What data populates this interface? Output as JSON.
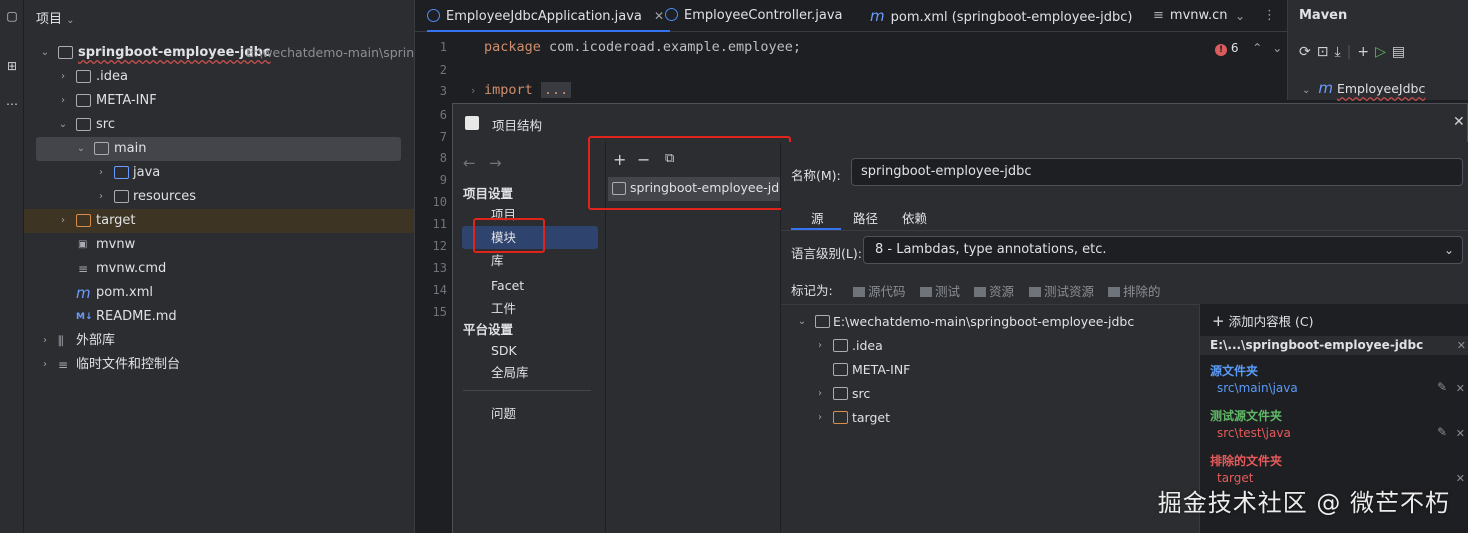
{
  "project": {
    "header": "项目",
    "tree": [
      {
        "label": "springboot-employee-jdbc",
        "path": "E:\\wechatdemo-main\\springb"
      },
      {
        "label": ".idea"
      },
      {
        "label": "META-INF"
      },
      {
        "label": "src"
      },
      {
        "label": "main"
      },
      {
        "label": "java"
      },
      {
        "label": "resources"
      },
      {
        "label": "target"
      },
      {
        "label": "mvnw"
      },
      {
        "label": "mvnw.cmd"
      },
      {
        "label": "pom.xml"
      },
      {
        "label": "README.md"
      },
      {
        "label": "外部库"
      },
      {
        "label": "临时文件和控制台"
      }
    ]
  },
  "editor": {
    "tabs": [
      {
        "label": "EmployeeJdbcApplication.java"
      },
      {
        "label": "EmployeeController.java"
      },
      {
        "label": "pom.xml (springboot-employee-jdbc)"
      },
      {
        "label": "mvnw.cn"
      }
    ],
    "line_numbers": [
      "1",
      "2",
      "3",
      "6",
      "7",
      "8",
      "9",
      "10",
      "11",
      "12",
      "13",
      "14",
      "15"
    ],
    "code": {
      "line1_kw": "package",
      "line1_rest": "com.icoderoad.example.employee;",
      "line3_kw": "import",
      "line3_rest": "..."
    },
    "problems_count": "6"
  },
  "maven": {
    "title": "Maven",
    "project_item": "EmployeeJdbc"
  },
  "dialog": {
    "title": "项目结构",
    "nav": {
      "project_settings_header": "项目设置",
      "items": [
        "项目",
        "模块",
        "库",
        "Facet",
        "工件"
      ],
      "platform_settings_header": "平台设置",
      "platform_items": [
        "SDK",
        "全局库"
      ],
      "problems": "问题"
    },
    "modules": {
      "module_name": "springboot-employee-jdbc"
    },
    "detail": {
      "name_label": "名称(M):",
      "name_value": "springboot-employee-jdbc",
      "tabs": [
        "源",
        "路径",
        "依赖"
      ],
      "language_level_label": "语言级别(L):",
      "language_level_value": "8 - Lambdas, type annotations, etc.",
      "mark_as_label": "标记为:",
      "mark_items": [
        "源代码",
        "测试",
        "资源",
        "测试资源",
        "排除的"
      ],
      "root_tree": [
        "E:\\wechatdemo-main\\springboot-employee-jdbc",
        ".idea",
        "META-INF",
        "src",
        "target"
      ],
      "add_content_root": "添加内容根 (C)",
      "content_root_title": "E:\\...\\springboot-employee-jdbc",
      "source_folders_label": "源文件夹",
      "source_folder_path": "src\\main\\java",
      "test_source_label": "测试源文件夹",
      "test_source_path": "src\\test\\java",
      "excluded_label": "排除的文件夹",
      "excluded_path": "target"
    }
  },
  "watermark": "掘金技术社区 @ 微芒不朽",
  "colors": {
    "accent": "#3574f0",
    "highlight": "#e0231b",
    "source_blue": "#5b9bf8",
    "test_green": "#5fb865",
    "excluded_red": "#e55b5b"
  }
}
